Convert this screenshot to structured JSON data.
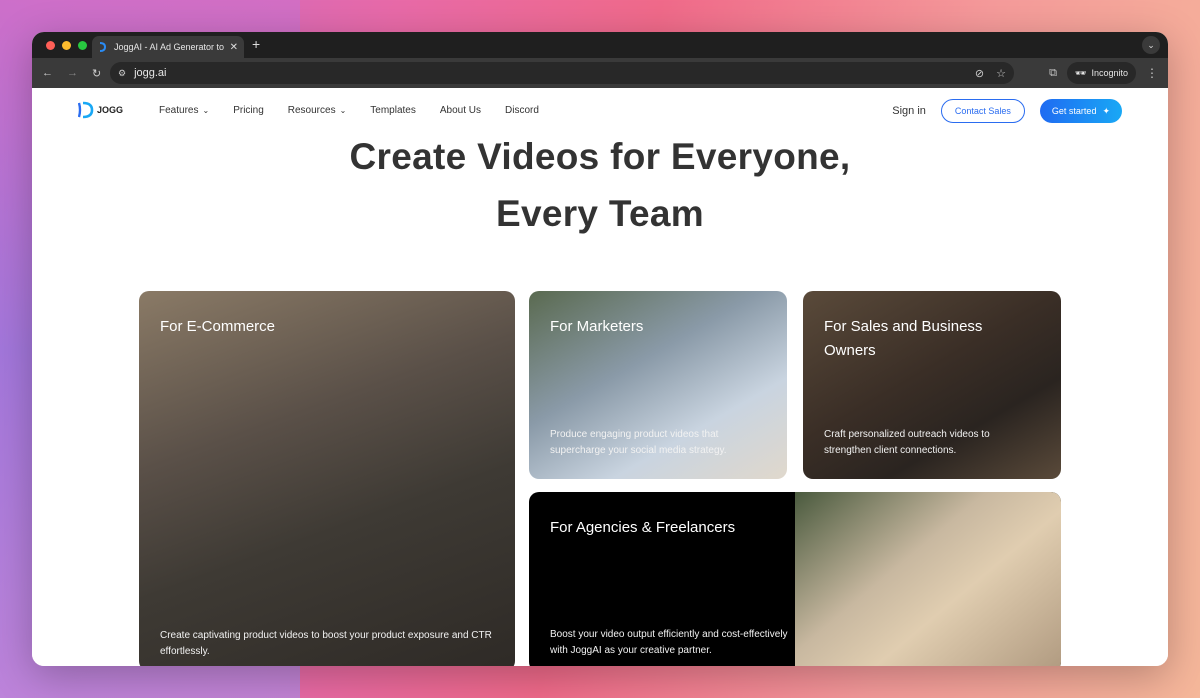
{
  "browser": {
    "tab_title": "JoggAI - AI Ad Generator to C",
    "url": "jogg.ai",
    "incognito_label": "Incognito"
  },
  "site": {
    "logo_text": "JOGG",
    "menu": [
      {
        "label": "Features",
        "dropdown": true
      },
      {
        "label": "Pricing",
        "dropdown": false
      },
      {
        "label": "Resources",
        "dropdown": true
      },
      {
        "label": "Templates",
        "dropdown": false
      },
      {
        "label": "About Us",
        "dropdown": false
      },
      {
        "label": "Discord",
        "dropdown": false
      }
    ],
    "signin": "Sign in",
    "contact_sales": "Contact Sales",
    "get_started": "Get started",
    "accent_color": "#2a6cf0"
  },
  "hero": {
    "line1": "Create Videos for Everyone,",
    "line2": "Every Team"
  },
  "cards": [
    {
      "title": "For E-Commerce",
      "desc": "Create captivating product videos to boost your product exposure and CTR effortlessly."
    },
    {
      "title": "For Marketers",
      "desc": "Produce engaging product videos that supercharge your social media strategy."
    },
    {
      "title": "For Sales and Business Owners",
      "desc": "Craft personalized outreach videos to strengthen client connections."
    },
    {
      "title": "For Agencies & Freelancers",
      "desc": "Boost your video output efficiently and cost-effectively with JoggAI as your creative partner."
    }
  ]
}
